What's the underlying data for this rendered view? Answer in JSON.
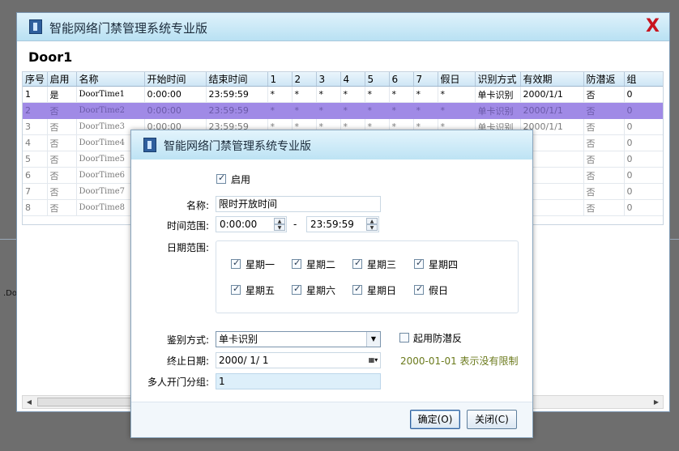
{
  "app": {
    "title": "智能网络门禁管理系统专业版",
    "close_glyph": "X",
    "background_text": ".Do"
  },
  "main": {
    "door_name": "Door1",
    "columns": [
      "序号",
      "启用",
      "名称",
      "开始时间",
      "结束时间",
      "1",
      "2",
      "3",
      "4",
      "5",
      "6",
      "7",
      "假日",
      "识别方式",
      "有效期",
      "防潜返",
      "组"
    ],
    "rows": [
      [
        "1",
        "是",
        "DoorTime1",
        "0:00:00",
        "23:59:59",
        "*",
        "*",
        "*",
        "*",
        "*",
        "*",
        "*",
        "*",
        "单卡识别",
        "2000/1/1",
        "否",
        "0"
      ],
      [
        "2",
        "否",
        "DoorTime2",
        "0:00:00",
        "23:59:59",
        "*",
        "*",
        "*",
        "*",
        "*",
        "*",
        "*",
        "*",
        "单卡识别",
        "2000/1/1",
        "否",
        "0"
      ],
      [
        "3",
        "否",
        "DoorTime3",
        "0:00:00",
        "23:59:59",
        "*",
        "*",
        "*",
        "*",
        "*",
        "*",
        "*",
        "*",
        "单卡识别",
        "2000/1/1",
        "否",
        "0"
      ],
      [
        "4",
        "否",
        "DoorTime4",
        "",
        "",
        "",
        "",
        "",
        "",
        "",
        "",
        "",
        "",
        "",
        "",
        "否",
        "0"
      ],
      [
        "5",
        "否",
        "DoorTime5",
        "",
        "",
        "",
        "",
        "",
        "",
        "",
        "",
        "",
        "",
        "",
        "",
        "否",
        "0"
      ],
      [
        "6",
        "否",
        "DoorTime6",
        "",
        "",
        "",
        "",
        "",
        "",
        "",
        "",
        "",
        "",
        "",
        "",
        "否",
        "0"
      ],
      [
        "7",
        "否",
        "DoorTime7",
        "",
        "",
        "",
        "",
        "",
        "",
        "",
        "",
        "",
        "",
        "",
        "",
        "否",
        "0"
      ],
      [
        "8",
        "否",
        "DoorTime8",
        "",
        "",
        "",
        "",
        "",
        "",
        "",
        "",
        "",
        "",
        "",
        "",
        "否",
        "0"
      ]
    ],
    "selected_row": 1
  },
  "dialog": {
    "title": "智能网络门禁管理系统专业版",
    "enable_label": "启用",
    "enable_checked": true,
    "name_label": "名称:",
    "name_value": "限时开放时间",
    "time_range_label": "时间范围:",
    "start_time": "0:00:00",
    "time_sep": "-",
    "end_time": "23:59:59",
    "date_range_label": "日期范围:",
    "days": [
      {
        "label": "星期一",
        "checked": true
      },
      {
        "label": "星期二",
        "checked": true
      },
      {
        "label": "星期三",
        "checked": true
      },
      {
        "label": "星期四",
        "checked": true
      },
      {
        "label": "星期五",
        "checked": true
      },
      {
        "label": "星期六",
        "checked": true
      },
      {
        "label": "星期日",
        "checked": true
      },
      {
        "label": "假日",
        "checked": true
      }
    ],
    "auth_label": "鉴别方式:",
    "auth_value": "单卡识别",
    "anti_passback_label": "起用防潜反",
    "anti_passback_checked": false,
    "end_date_label": "终止日期:",
    "end_date_value": "2000/ 1/ 1",
    "no_limit_hint": "2000-01-01 表示没有限制",
    "multi_group_label": "多人开门分组:",
    "multi_group_value": "1",
    "ok_label": "确定(O)",
    "close_label": "关闭(C)"
  }
}
